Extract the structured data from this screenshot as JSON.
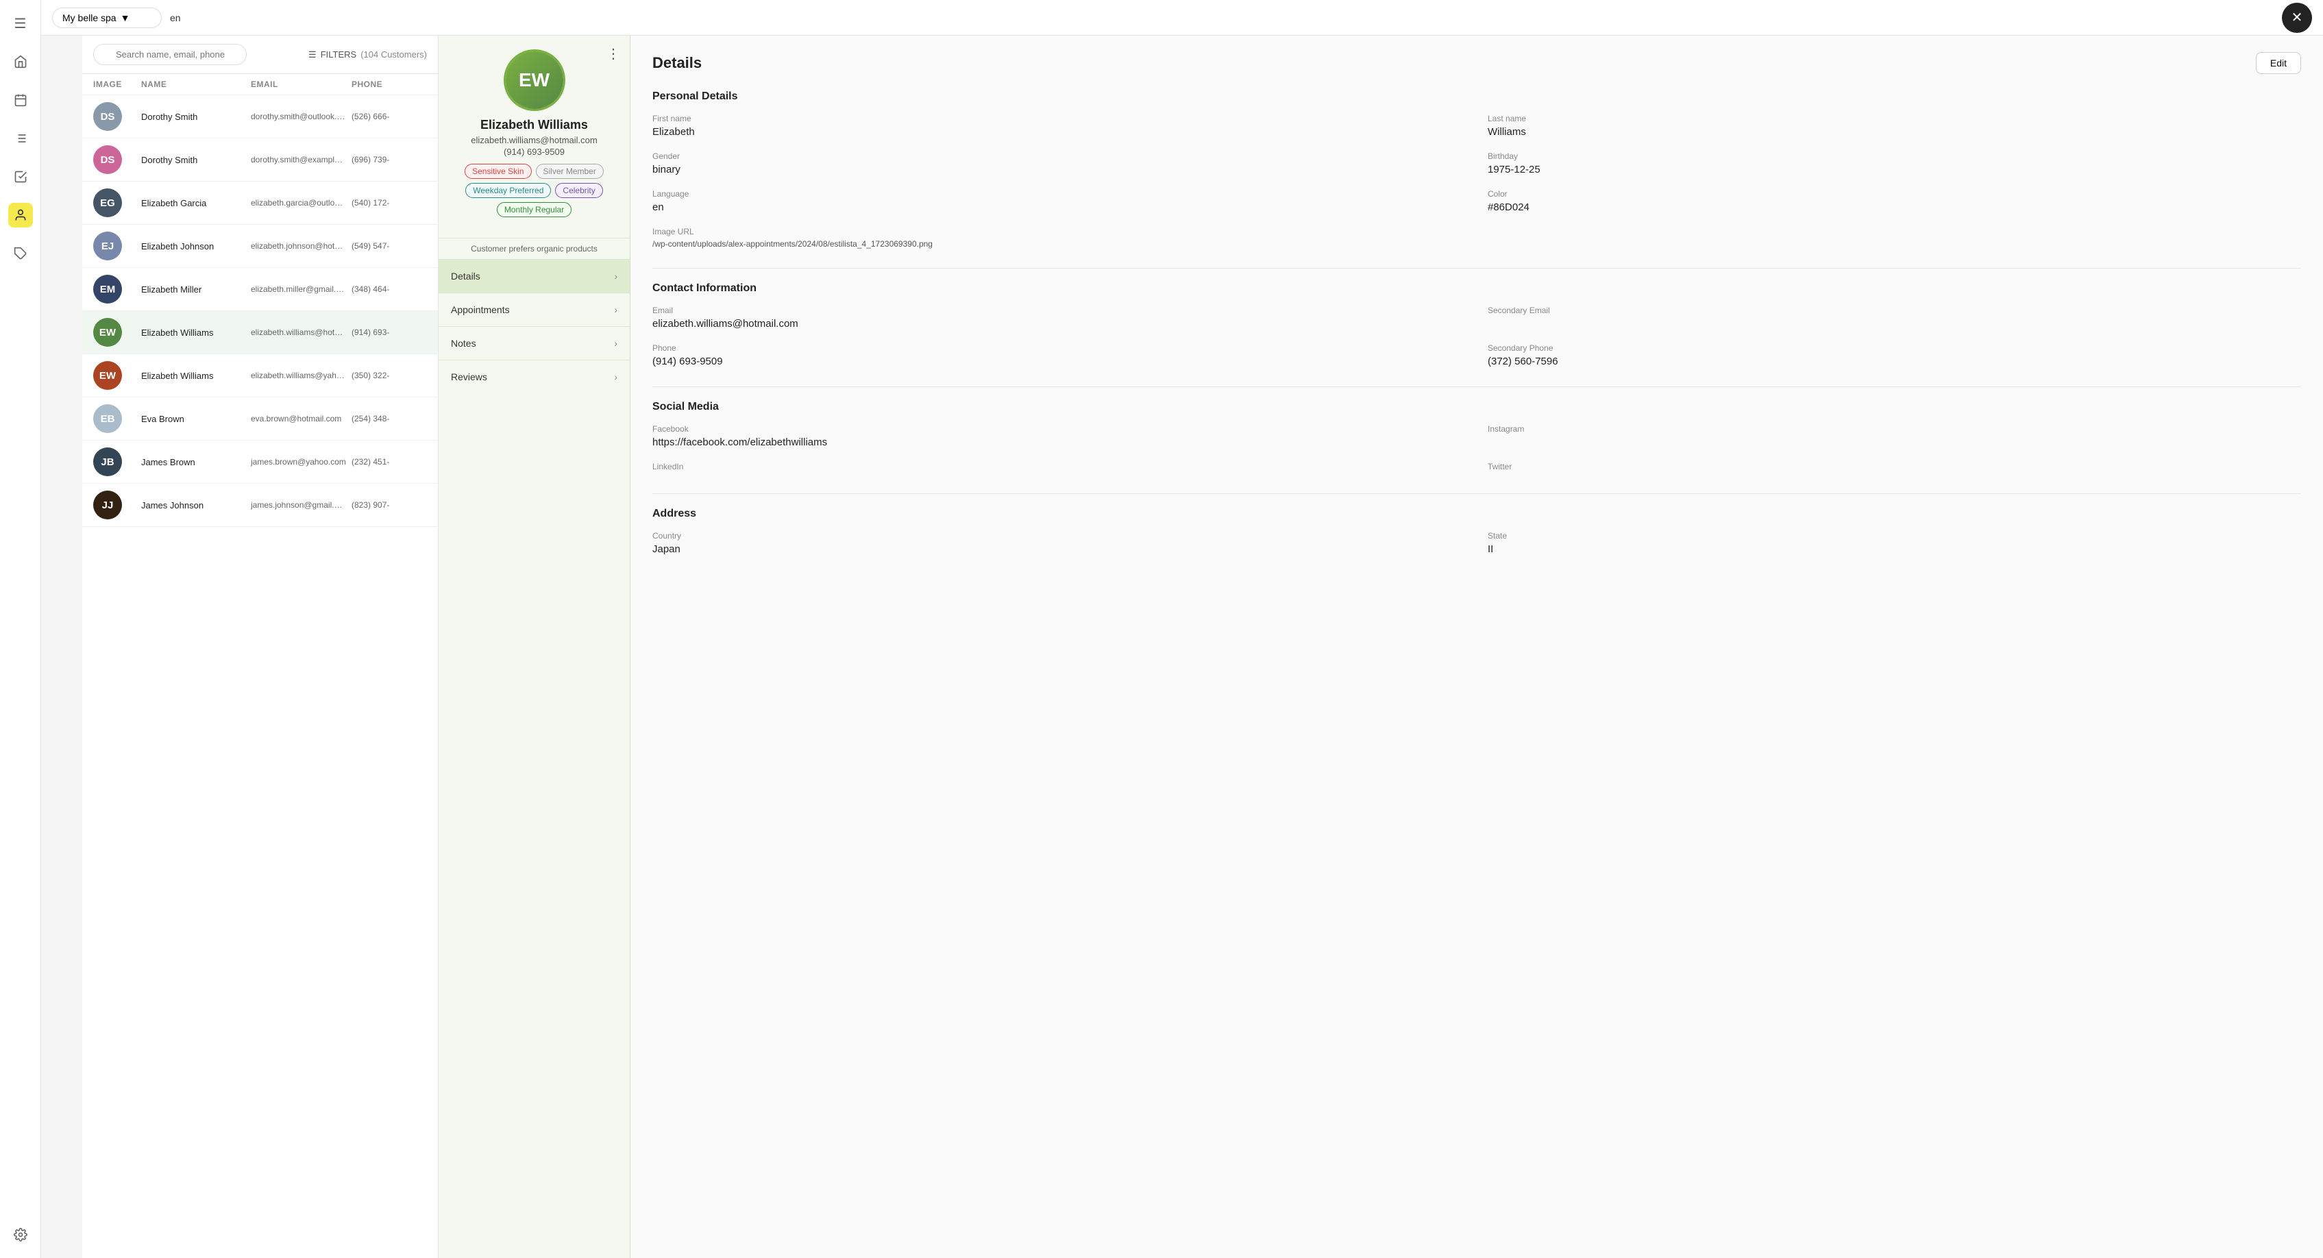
{
  "sidebar": {
    "items": [
      {
        "name": "menu-icon",
        "label": "☰",
        "active": false
      },
      {
        "name": "home-icon",
        "label": "⌂",
        "active": false
      },
      {
        "name": "calendar-icon",
        "label": "📅",
        "active": false
      },
      {
        "name": "tasks-icon",
        "label": "≡",
        "active": false
      },
      {
        "name": "checklist-icon",
        "label": "✓",
        "active": false
      },
      {
        "name": "contacts-icon",
        "label": "👤",
        "active": true
      },
      {
        "name": "tags-icon",
        "label": "🏷",
        "active": false
      }
    ],
    "settings_label": "⚙"
  },
  "topbar": {
    "spa_name": "My belle spa",
    "language": "en",
    "close_symbol": "✕"
  },
  "customer_list": {
    "search_placeholder": "Search name, email, phone",
    "filters_label": "FILTERS",
    "customer_count": "(104 Customers)",
    "columns": [
      "IMAGE",
      "NAME",
      "EMAIL",
      "PHONE"
    ],
    "rows": [
      {
        "name": "Dorothy Smith",
        "email": "dorothy.smith@outlook.com",
        "phone": "(526) 666-",
        "color": "#8899aa"
      },
      {
        "name": "Dorothy Smith",
        "email": "dorothy.smith@example.com",
        "phone": "(696) 739-",
        "color": "#cc6699"
      },
      {
        "name": "Elizabeth Garcia",
        "email": "elizabeth.garcia@outlook.c...",
        "phone": "(540) 172-",
        "color": "#445566"
      },
      {
        "name": "Elizabeth Johnson",
        "email": "elizabeth.johnson@hotmail...",
        "phone": "(549) 547-",
        "color": "#7788aa"
      },
      {
        "name": "Elizabeth Miller",
        "email": "elizabeth.miller@gmail.com",
        "phone": "(348) 464-",
        "color": "#334466"
      },
      {
        "name": "Elizabeth Williams",
        "email": "elizabeth.williams@hotmail...",
        "phone": "(914) 693-",
        "color": "#558844",
        "active": true
      },
      {
        "name": "Elizabeth Williams",
        "email": "elizabeth.williams@yahoo.c...",
        "phone": "(350) 322-",
        "color": "#aa4422"
      },
      {
        "name": "Eva Brown",
        "email": "eva.brown@hotmail.com",
        "phone": "(254) 348-",
        "color": "#aabbcc"
      },
      {
        "name": "James Brown",
        "email": "james.brown@yahoo.com",
        "phone": "(232) 451-",
        "color": "#334455"
      },
      {
        "name": "James Johnson",
        "email": "james.johnson@gmail.com",
        "phone": "(823) 907-",
        "color": "#332211"
      }
    ]
  },
  "profile": {
    "name": "Elizabeth Williams",
    "email": "elizabeth.williams@hotmail.com",
    "phone": "(914) 693-9509",
    "note": "Customer prefers organic products",
    "tags": [
      {
        "label": "Sensitive Skin",
        "type": "pink"
      },
      {
        "label": "Silver Member",
        "type": "gray"
      },
      {
        "label": "Weekday Preferred",
        "type": "teal"
      },
      {
        "label": "Celebrity",
        "type": "purple"
      },
      {
        "label": "Monthly Regular",
        "type": "green"
      }
    ],
    "nav": [
      {
        "label": "Details",
        "active": true
      },
      {
        "label": "Appointments",
        "active": false
      },
      {
        "label": "Notes",
        "active": false
      },
      {
        "label": "Reviews",
        "active": false
      }
    ],
    "menu_symbol": "⋮"
  },
  "details": {
    "title": "Details",
    "edit_label": "Edit",
    "sections": {
      "personal": {
        "title": "Personal Details",
        "fields": [
          {
            "label": "First name",
            "value": "Elizabeth",
            "col": "left"
          },
          {
            "label": "Last name",
            "value": "Williams",
            "col": "right"
          },
          {
            "label": "Gender",
            "value": "binary",
            "col": "left"
          },
          {
            "label": "Birthday",
            "value": "1975-12-25",
            "col": "right"
          },
          {
            "label": "Language",
            "value": "en",
            "col": "left"
          },
          {
            "label": "Color",
            "value": "#86D024",
            "col": "right"
          },
          {
            "label": "Image URL",
            "value": "/wp-content/uploads/alex-appointments/2024/08/estilista_4_1723069390.png",
            "col": "full"
          }
        ]
      },
      "contact": {
        "title": "Contact Information",
        "fields": [
          {
            "label": "Email",
            "value": "elizabeth.williams@hotmail.com",
            "col": "left"
          },
          {
            "label": "Secondary Email",
            "value": "",
            "col": "right"
          },
          {
            "label": "Phone",
            "value": "(914) 693-9509",
            "col": "left"
          },
          {
            "label": "Secondary Phone",
            "value": "(372) 560-7596",
            "col": "right"
          }
        ]
      },
      "social": {
        "title": "Social Media",
        "fields": [
          {
            "label": "Facebook",
            "value": "https://facebook.com/elizabethwilliams",
            "col": "left"
          },
          {
            "label": "Instagram",
            "value": "",
            "col": "right"
          },
          {
            "label": "LinkedIn",
            "value": "",
            "col": "left"
          },
          {
            "label": "Twitter",
            "value": "",
            "col": "right"
          }
        ]
      },
      "address": {
        "title": "Address",
        "fields": [
          {
            "label": "Country",
            "value": "Japan",
            "col": "left"
          },
          {
            "label": "State",
            "value": "II",
            "col": "right"
          }
        ]
      }
    }
  }
}
